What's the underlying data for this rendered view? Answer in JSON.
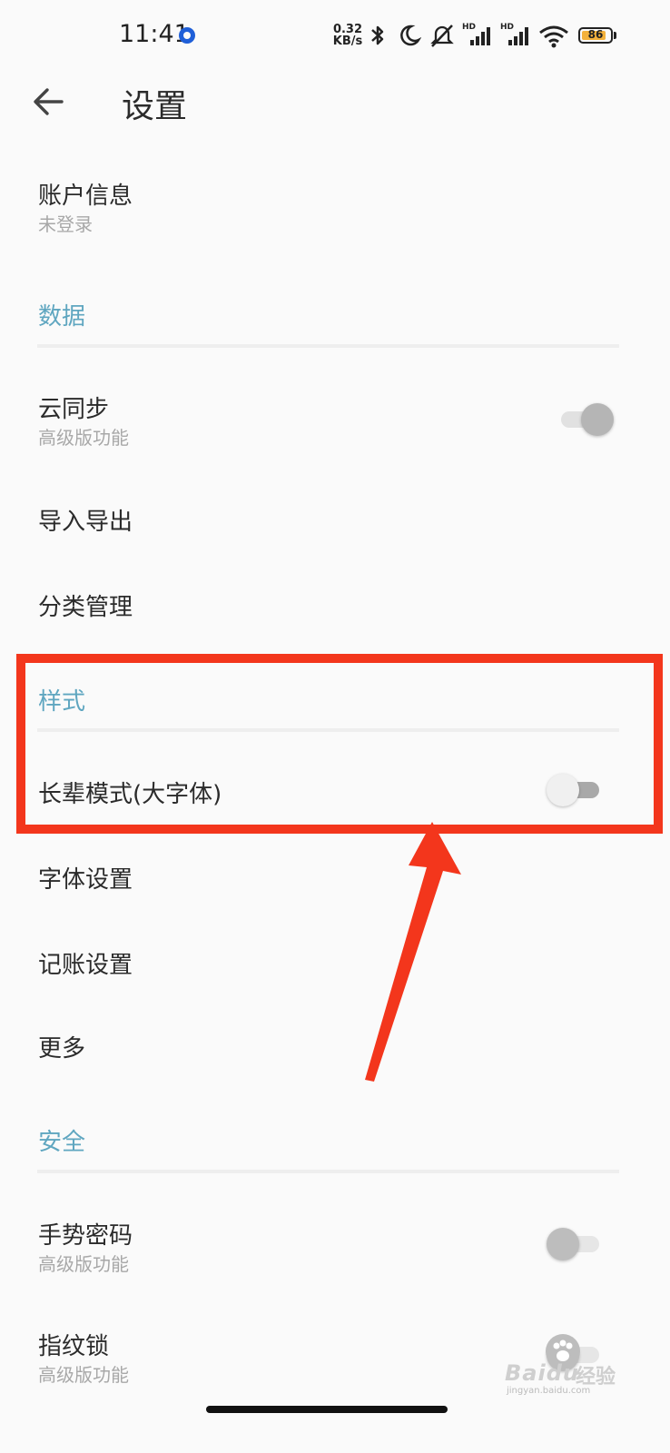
{
  "status_bar": {
    "time": "11:41",
    "net_speed_value": "0.32",
    "net_speed_unit": "KB/s",
    "hd_label_1": "HD",
    "hd_label_2": "HD",
    "battery_level": "86",
    "battery_color": "#f3b13b"
  },
  "header": {
    "back_icon": "arrow-left-icon",
    "title": "设置"
  },
  "account": {
    "title": "账户信息",
    "subtitle": "未登录"
  },
  "sections": {
    "data": {
      "label": "数据",
      "items": [
        {
          "title": "云同步",
          "subtitle": "高级版功能",
          "toggle": "on"
        },
        {
          "title": "导入导出"
        },
        {
          "title": "分类管理"
        }
      ]
    },
    "style": {
      "label": "样式",
      "items": [
        {
          "title": "长辈模式(大字体)",
          "toggle": "off"
        },
        {
          "title": "字体设置"
        },
        {
          "title": "记账设置"
        },
        {
          "title": "更多"
        }
      ]
    },
    "security": {
      "label": "安全",
      "items": [
        {
          "title": "手势密码",
          "subtitle": "高级版功能",
          "toggle": "off"
        },
        {
          "title": "指纹锁",
          "subtitle": "高级版功能",
          "toggle": "off"
        }
      ]
    }
  },
  "colors": {
    "section_accent": "#5fa6c0",
    "annotation_red": "#f3361c"
  },
  "watermark": {
    "brand": "Baidu",
    "product": "经验",
    "url": "jingyan.baidu.com"
  }
}
